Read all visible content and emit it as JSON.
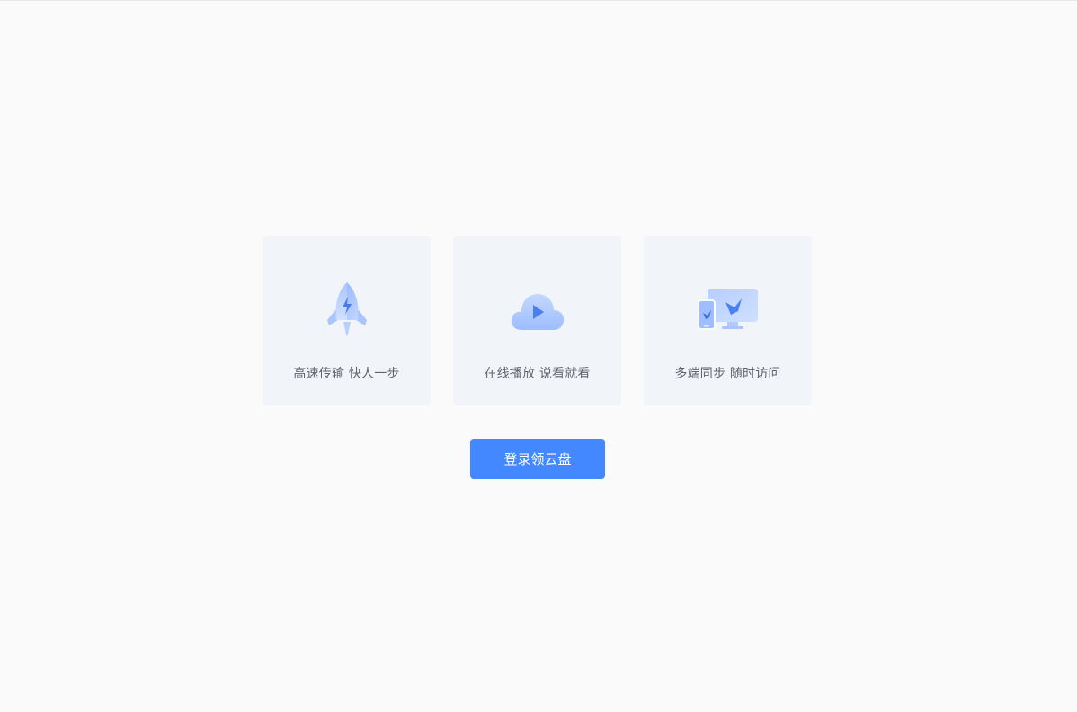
{
  "features": [
    {
      "icon": "rocket-icon",
      "label": "高速传输 快人一步"
    },
    {
      "icon": "cloud-play-icon",
      "label": "在线播放 说看就看"
    },
    {
      "icon": "multi-device-icon",
      "label": "多端同步 随时访问"
    }
  ],
  "login_button": {
    "label": "登录领云盘"
  },
  "colors": {
    "background": "#fafafa",
    "card": "#f1f4f9",
    "accent": "#4488ff",
    "text": "#60646b"
  }
}
